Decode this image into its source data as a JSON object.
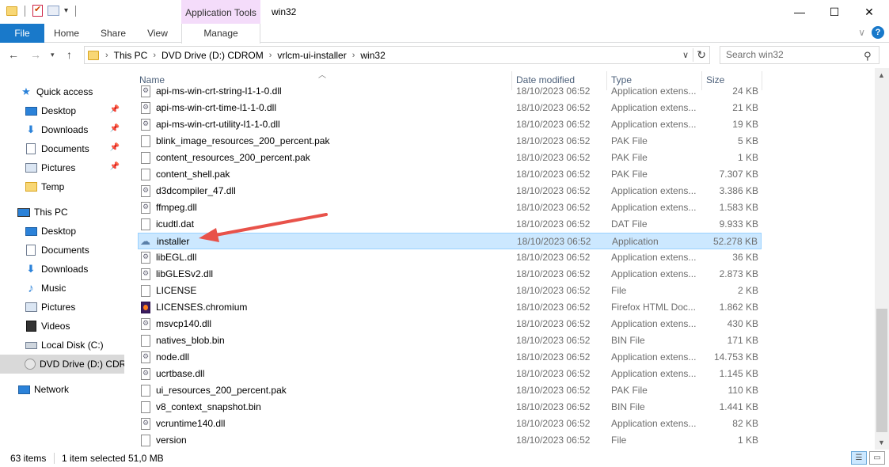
{
  "window": {
    "title": "win32",
    "app_tools_tab": "Application Tools",
    "minimize": "—",
    "maximize": "☐",
    "close": "✕"
  },
  "ribbon": {
    "tabs": [
      "File",
      "Home",
      "Share",
      "View",
      "Manage"
    ],
    "expand": "∨",
    "help": "?"
  },
  "address": {
    "crumbs": [
      "This PC",
      "DVD Drive (D:) CDROM",
      "vrlcm-ui-installer",
      "win32"
    ],
    "search_placeholder": "Search win32"
  },
  "navpane": {
    "quick_access": "Quick access",
    "quick_items": [
      "Desktop",
      "Downloads",
      "Documents",
      "Pictures",
      "Temp"
    ],
    "this_pc": "This PC",
    "pc_items": [
      "Desktop",
      "Documents",
      "Downloads",
      "Music",
      "Pictures",
      "Videos",
      "Local Disk (C:)",
      "DVD Drive (D:) CDROM"
    ],
    "network": "Network"
  },
  "columns": {
    "name": "Name",
    "date": "Date modified",
    "type": "Type",
    "size": "Size"
  },
  "files": [
    {
      "name": "api-ms-win-crt-string-l1-1-0.dll",
      "date": "18/10/2023 06:52",
      "type": "Application extens...",
      "size": "24 KB",
      "icon": "dll"
    },
    {
      "name": "api-ms-win-crt-time-l1-1-0.dll",
      "date": "18/10/2023 06:52",
      "type": "Application extens...",
      "size": "21 KB",
      "icon": "dll"
    },
    {
      "name": "api-ms-win-crt-utility-l1-1-0.dll",
      "date": "18/10/2023 06:52",
      "type": "Application extens...",
      "size": "19 KB",
      "icon": "dll"
    },
    {
      "name": "blink_image_resources_200_percent.pak",
      "date": "18/10/2023 06:52",
      "type": "PAK File",
      "size": "5 KB",
      "icon": "file"
    },
    {
      "name": "content_resources_200_percent.pak",
      "date": "18/10/2023 06:52",
      "type": "PAK File",
      "size": "1 KB",
      "icon": "file"
    },
    {
      "name": "content_shell.pak",
      "date": "18/10/2023 06:52",
      "type": "PAK File",
      "size": "7.307 KB",
      "icon": "file"
    },
    {
      "name": "d3dcompiler_47.dll",
      "date": "18/10/2023 06:52",
      "type": "Application extens...",
      "size": "3.386 KB",
      "icon": "dll"
    },
    {
      "name": "ffmpeg.dll",
      "date": "18/10/2023 06:52",
      "type": "Application extens...",
      "size": "1.583 KB",
      "icon": "dll"
    },
    {
      "name": "icudtl.dat",
      "date": "18/10/2023 06:52",
      "type": "DAT File",
      "size": "9.933 KB",
      "icon": "file"
    },
    {
      "name": "installer",
      "date": "18/10/2023 06:52",
      "type": "Application",
      "size": "52.278 KB",
      "icon": "app",
      "selected": true
    },
    {
      "name": "libEGL.dll",
      "date": "18/10/2023 06:52",
      "type": "Application extens...",
      "size": "36 KB",
      "icon": "dll"
    },
    {
      "name": "libGLESv2.dll",
      "date": "18/10/2023 06:52",
      "type": "Application extens...",
      "size": "2.873 KB",
      "icon": "dll"
    },
    {
      "name": "LICENSE",
      "date": "18/10/2023 06:52",
      "type": "File",
      "size": "2 KB",
      "icon": "file"
    },
    {
      "name": "LICENSES.chromium",
      "date": "18/10/2023 06:52",
      "type": "Firefox HTML Doc...",
      "size": "1.862 KB",
      "icon": "ff"
    },
    {
      "name": "msvcp140.dll",
      "date": "18/10/2023 06:52",
      "type": "Application extens...",
      "size": "430 KB",
      "icon": "dll"
    },
    {
      "name": "natives_blob.bin",
      "date": "18/10/2023 06:52",
      "type": "BIN File",
      "size": "171 KB",
      "icon": "file"
    },
    {
      "name": "node.dll",
      "date": "18/10/2023 06:52",
      "type": "Application extens...",
      "size": "14.753 KB",
      "icon": "dll"
    },
    {
      "name": "ucrtbase.dll",
      "date": "18/10/2023 06:52",
      "type": "Application extens...",
      "size": "1.145 KB",
      "icon": "dll"
    },
    {
      "name": "ui_resources_200_percent.pak",
      "date": "18/10/2023 06:52",
      "type": "PAK File",
      "size": "110 KB",
      "icon": "file"
    },
    {
      "name": "v8_context_snapshot.bin",
      "date": "18/10/2023 06:52",
      "type": "BIN File",
      "size": "1.441 KB",
      "icon": "file"
    },
    {
      "name": "vcruntime140.dll",
      "date": "18/10/2023 06:52",
      "type": "Application extens...",
      "size": "82 KB",
      "icon": "dll"
    },
    {
      "name": "version",
      "date": "18/10/2023 06:52",
      "type": "File",
      "size": "1 KB",
      "icon": "file"
    }
  ],
  "status": {
    "count": "63 items",
    "selected": "1 item selected",
    "size": "51,0 MB"
  },
  "colors": {
    "accent": "#1979ca",
    "selection": "#cce8ff",
    "annotation_arrow": "#e8524a"
  }
}
